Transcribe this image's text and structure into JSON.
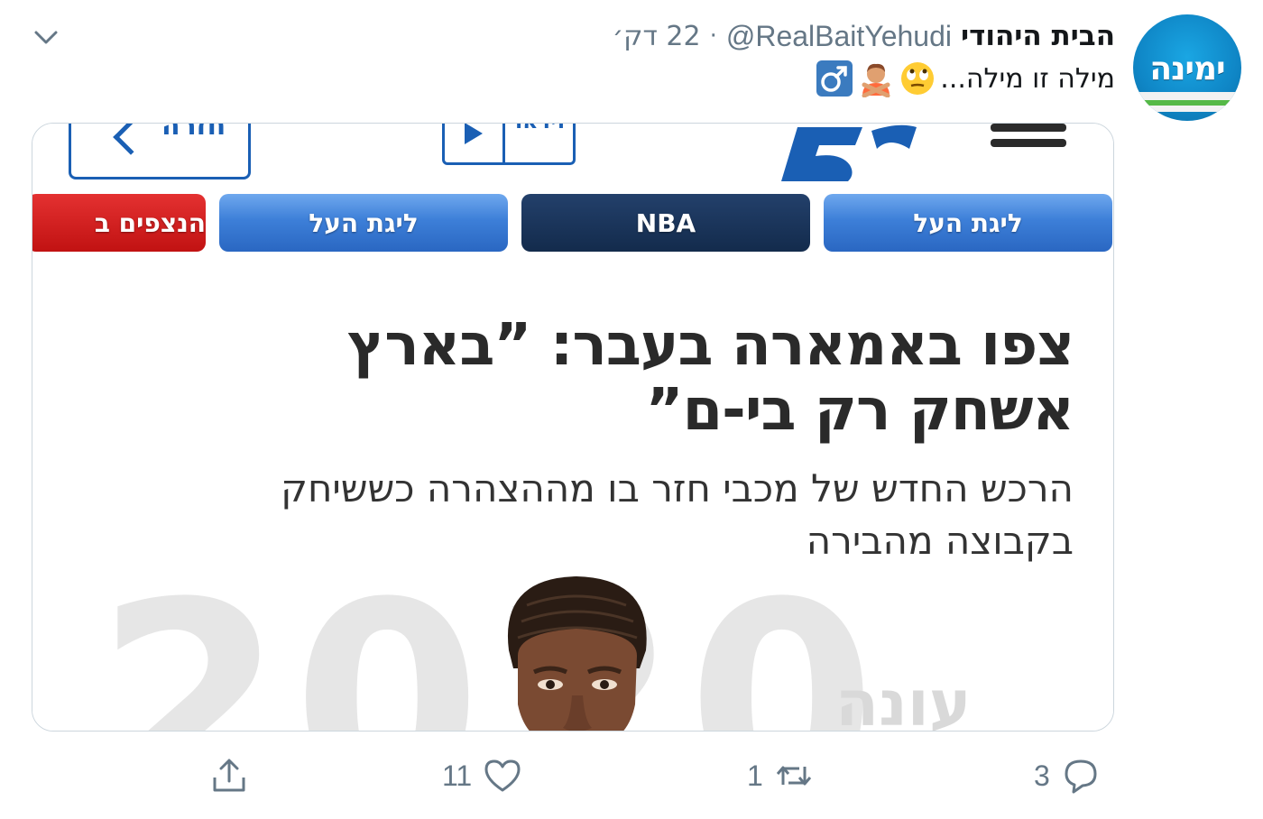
{
  "tweet": {
    "display_name": "הבית היהודי",
    "handle": "@RealBaitYehudi",
    "separator": "·",
    "time": "22 דק׳",
    "text": "מילה זו מילה...",
    "emojis": [
      "face-with-rolling-eyes-emoji",
      "person-gesturing-no-emoji",
      "male-sign-emoji"
    ],
    "avatar_text": "ימינה"
  },
  "media": {
    "top_nav": {
      "login_label": "חזרה",
      "video_label": "וידאו"
    },
    "tabs": [
      {
        "label": "ליגת העל",
        "style": "blue"
      },
      {
        "label": "NBA",
        "style": "dark"
      },
      {
        "label": "ליגת העל",
        "style": "blue"
      },
      {
        "label": "הנצפים ב",
        "style": "red"
      }
    ],
    "headline_line1": "צפו באמארה בעבר: ”בארץ",
    "headline_line2": "אשחק רק בי-ם”",
    "subline_line1": "הרכש החדש של מכבי חזר בו מההצהרה כששיחק",
    "subline_line2": "בקבוצה מהבירה",
    "background_number": "2020",
    "watermark": "עונה"
  },
  "actions": {
    "reply_count": "3",
    "retweet_count": "1",
    "like_count": "11"
  },
  "colors": {
    "text_primary": "#14171a",
    "text_secondary": "#657786",
    "border": "#ccd6dd",
    "site_blue": "#1a5fb4"
  }
}
